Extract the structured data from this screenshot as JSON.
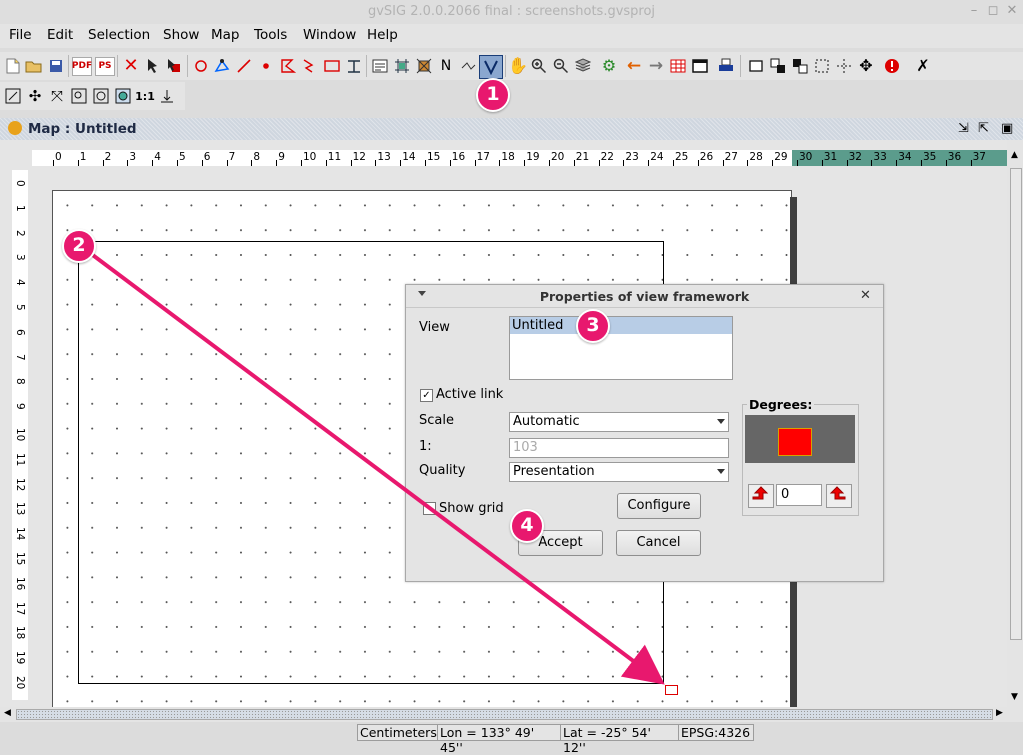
{
  "window": {
    "title": "gvSIG 2.0.0.2066 final : screenshots.gvsproj",
    "minimize": "–",
    "maximize": "◻",
    "close": "✕"
  },
  "menu": [
    {
      "label": "File"
    },
    {
      "label": "Edit"
    },
    {
      "label": "Selection"
    },
    {
      "label": "Show"
    },
    {
      "label": "Map"
    },
    {
      "label": "Tools"
    },
    {
      "label": "Window"
    },
    {
      "label": "Help"
    }
  ],
  "toolbar_icons": {
    "new": "new-icon",
    "open": "open-icon",
    "save": "save-icon",
    "pdf": "PDF",
    "ps": "PS",
    "delete": "delete-icon",
    "select": "select-icon",
    "hand": "pan-icon"
  },
  "map_frame": {
    "title": "Map : Untitled"
  },
  "ruler": {
    "h": [
      "0",
      "1",
      "2",
      "3",
      "4",
      "5",
      "6",
      "7",
      "8",
      "9",
      "10",
      "11",
      "12",
      "13",
      "14",
      "15",
      "16",
      "17",
      "18",
      "19",
      "20",
      "21",
      "22",
      "23",
      "24",
      "25",
      "26",
      "27",
      "28",
      "29",
      "30",
      "31",
      "32",
      "33",
      "34",
      "35",
      "36",
      "37"
    ],
    "v": [
      "0",
      "1",
      "2",
      "3",
      "4",
      "5",
      "6",
      "7",
      "8",
      "9",
      "10",
      "11",
      "12",
      "13",
      "14",
      "15",
      "16",
      "17",
      "18",
      "19",
      "20"
    ]
  },
  "dialog": {
    "title": "Properties of view framework",
    "view_label": "View",
    "view_items": [
      "Untitled"
    ],
    "active_link_label": "Active link",
    "active_link_checked": true,
    "scale_label": "Scale",
    "scale_value": "Automatic",
    "ratio_label": "1:",
    "ratio_value": "103",
    "quality_label": "Quality",
    "quality_value": "Presentation",
    "show_grid_label": "Show grid",
    "show_grid_checked": false,
    "degrees_label": "Degrees:",
    "degrees_value": "0",
    "configure_label": "Configure",
    "accept_label": "Accept",
    "cancel_label": "Cancel"
  },
  "badges": [
    "1",
    "2",
    "3",
    "4"
  ],
  "status": {
    "units": "Centimeters",
    "lon": "Lon = 133° 49' 45''",
    "lat": "Lat = -25° 54' 12''",
    "epsg": "EPSG:4326"
  },
  "colors": {
    "accent": "#e8186e",
    "ruler_bg": "#5b9c8c",
    "swatch": "#ff0000"
  }
}
